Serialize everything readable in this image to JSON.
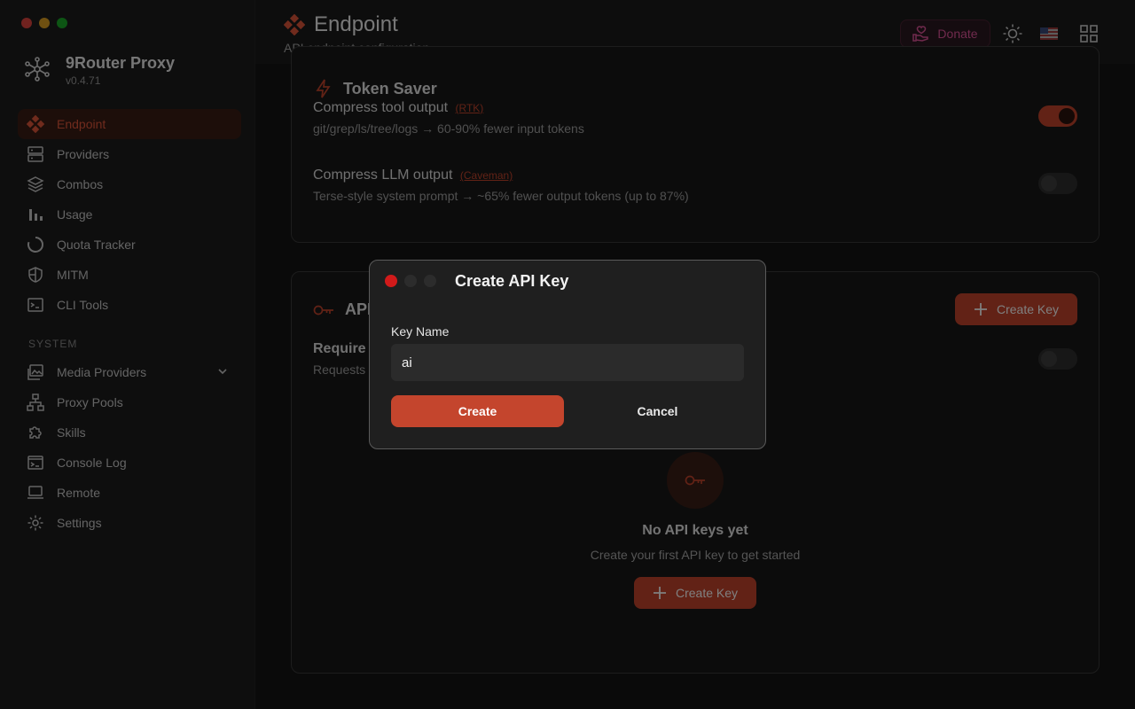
{
  "window": {
    "controls": [
      "#e0443e",
      "#dea123",
      "#1aab29"
    ]
  },
  "brand": {
    "name": "9Router Proxy",
    "version": "v0.4.71"
  },
  "sidebar": {
    "items": [
      {
        "label": "Endpoint",
        "icon": "endpoint-icon",
        "active": true
      },
      {
        "label": "Providers",
        "icon": "server-icon"
      },
      {
        "label": "Combos",
        "icon": "layers-icon"
      },
      {
        "label": "Usage",
        "icon": "bar-chart-icon"
      },
      {
        "label": "Quota Tracker",
        "icon": "circle-progress-icon"
      },
      {
        "label": "MITM",
        "icon": "shield-icon"
      },
      {
        "label": "CLI Tools",
        "icon": "terminal-icon"
      }
    ],
    "system_label": "SYSTEM",
    "system_items": [
      {
        "label": "Media Providers",
        "icon": "media-icon"
      },
      {
        "label": "Proxy Pools",
        "icon": "network-icon"
      },
      {
        "label": "Skills",
        "icon": "puzzle-icon"
      },
      {
        "label": "Console Log",
        "icon": "console-icon"
      },
      {
        "label": "Remote",
        "icon": "laptop-icon"
      },
      {
        "label": "Settings",
        "icon": "gear-icon"
      }
    ]
  },
  "header": {
    "title": "Endpoint",
    "subtitle": "API endpoint configuration",
    "donate_label": "Donate"
  },
  "token_saver": {
    "title": "Token Saver",
    "options": [
      {
        "title": "Compress tool output",
        "tag": "(RTK)",
        "desc": "git/grep/ls/tree/logs → 60-90% fewer input tokens",
        "enabled": true
      },
      {
        "title": "Compress LLM output",
        "tag": "(Caveman)",
        "desc": "Terse-style system prompt → ~65% fewer output tokens (up to 87%)",
        "enabled": false
      }
    ]
  },
  "api_keys": {
    "title": "API",
    "create_key_label": "Create Key",
    "require_title": "Require",
    "require_desc": "Requests",
    "empty_title": "No API keys yet",
    "empty_desc": "Create your first API key to get started",
    "empty_button": "Create Key"
  },
  "modal": {
    "title": "Create API Key",
    "field_label": "Key Name",
    "field_value": "ai",
    "create_label": "Create",
    "cancel_label": "Cancel",
    "controls": [
      "#e0443e",
      "#3a3a3a",
      "#3a3a3a"
    ]
  },
  "colors": {
    "accent": "#c4452d",
    "donate": "#e0559a"
  }
}
